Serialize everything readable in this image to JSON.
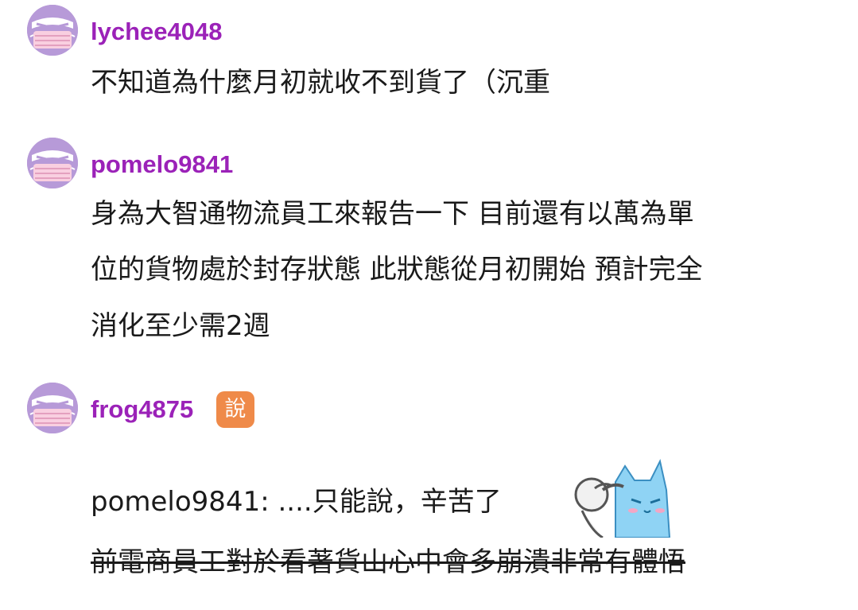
{
  "comments": [
    {
      "username": "lychee4048",
      "avatar_icon": "masked-face-avatar-icon",
      "lines": [
        "不知道為什麼月初就收不到貨了（沉重"
      ]
    },
    {
      "username": "pomelo9841",
      "avatar_icon": "masked-face-avatar-icon",
      "lines": [
        "身為大智通物流員工來報告一下 目前還有以萬為單",
        "位的貨物處於封存狀態 此狀態從月初開始 預計完全",
        "消化至少需2週"
      ]
    },
    {
      "username": "frog4875",
      "avatar_icon": "masked-face-avatar-icon",
      "badge": "說",
      "reply_text": "pomelo9841: ....只能說，辛苦了",
      "sticker_icon": "pat-on-head-sticker-icon",
      "strike_text": "前電商員工對於看著貨山心中會多崩潰非常有體悟"
    }
  ],
  "colors": {
    "username": "#9b22b8",
    "avatar_bg": "#b79ad8",
    "badge_bg": "#ef8a49",
    "text": "#1a1a1a"
  }
}
